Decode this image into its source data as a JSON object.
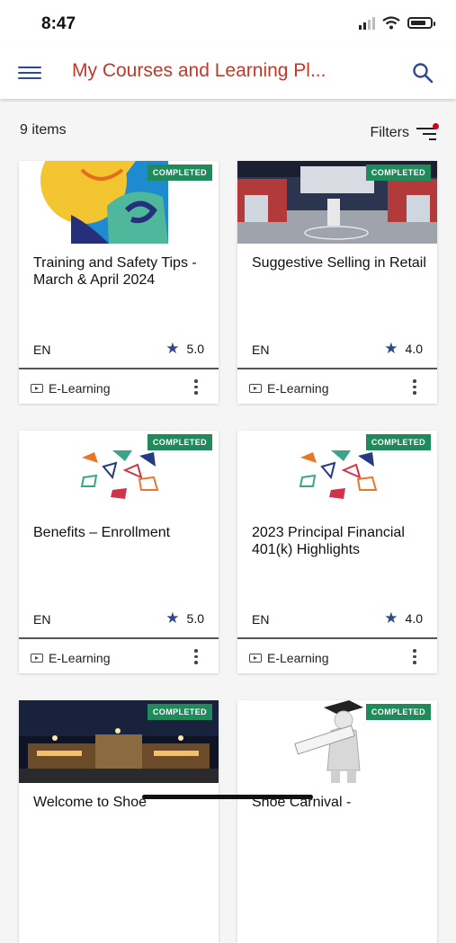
{
  "status": {
    "time": "8:47"
  },
  "appbar": {
    "title": "My Courses and Learning Pl..."
  },
  "list": {
    "count": "9 items",
    "filters_label": "Filters"
  },
  "colors": {
    "title": "#c0392b",
    "accent": "#2f4a8a",
    "badge": "#1f8a5a"
  },
  "courses": [
    {
      "title": "Training and Safety Tips - March & April 2024",
      "badge": "COMPLETED",
      "language": "EN",
      "rating": "5.0",
      "type": "E-Learning",
      "thumb": "safety-art"
    },
    {
      "title": "Suggestive Selling in Retail",
      "badge": "COMPLETED",
      "language": "EN",
      "rating": "4.0",
      "type": "E-Learning",
      "thumb": "store-photo"
    },
    {
      "title": "Benefits – Enrollment",
      "badge": "COMPLETED",
      "language": "EN",
      "rating": "5.0",
      "type": "E-Learning",
      "thumb": "benefits-shapes"
    },
    {
      "title": "2023 Principal Financial 401(k) Highlights",
      "badge": "COMPLETED",
      "language": "EN",
      "rating": "4.0",
      "type": "E-Learning",
      "thumb": "benefits-shapes"
    },
    {
      "title": "Welcome to Shoe",
      "badge": "COMPLETED",
      "thumb": "building-night-photo"
    },
    {
      "title": "Shoe Carnival -",
      "badge": "COMPLETED",
      "thumb": "graduate-figure"
    }
  ]
}
